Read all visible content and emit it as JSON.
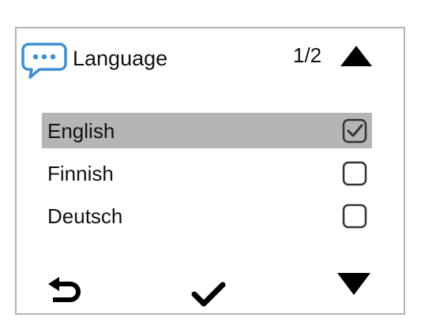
{
  "header": {
    "icon": "chat-bubble-icon",
    "title": "Language",
    "page_counter": "1/2",
    "page_up_icon": "triangle-up-icon"
  },
  "options": [
    {
      "label": "English",
      "checked": true,
      "highlighted": true
    },
    {
      "label": "Finnish",
      "checked": false,
      "highlighted": false
    },
    {
      "label": "Deutsch",
      "checked": false,
      "highlighted": false
    }
  ],
  "footer": {
    "back_icon": "return-arrow-icon",
    "confirm_icon": "checkmark-icon",
    "page_down_icon": "triangle-down-icon"
  },
  "colors": {
    "accent": "#3f8fd3",
    "highlight": "#b5b5b5",
    "border": "#b3b3b3",
    "text": "#111111"
  }
}
